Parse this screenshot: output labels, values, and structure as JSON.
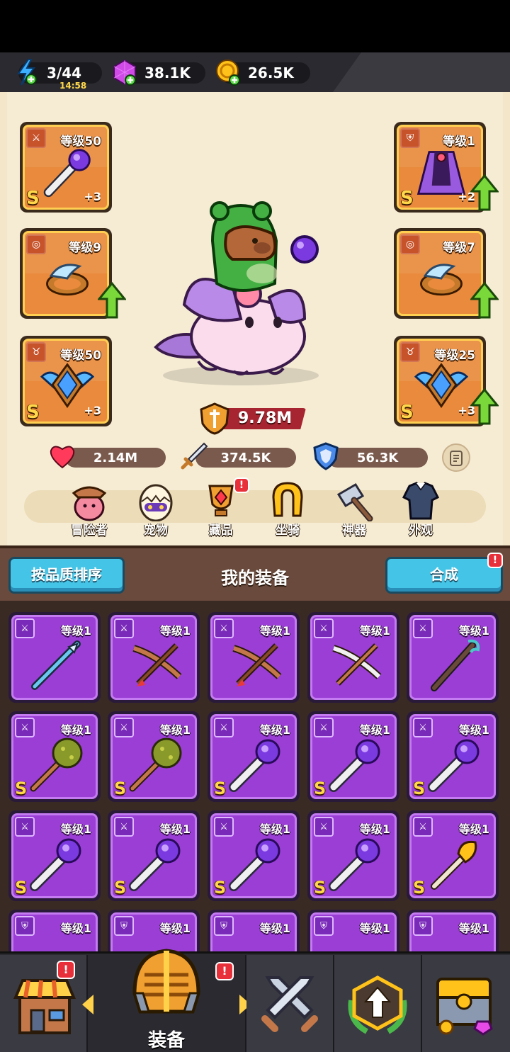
{
  "resources": {
    "energy": {
      "value": "3/44",
      "timer": "14:58",
      "icon": "lightning-bolt-icon"
    },
    "gems": {
      "value": "38.1K",
      "icon": "purple-gem-icon"
    },
    "coins": {
      "value": "26.5K",
      "icon": "gold-coin-icon"
    }
  },
  "left_slots": [
    {
      "level": "等级50",
      "rank": "S",
      "plus": "+3",
      "type": "weapon-icon",
      "item": "purple-orb-staff"
    },
    {
      "level": "等级9",
      "rank": "",
      "plus": "",
      "type": "ring-icon",
      "item": "wing-ring",
      "upgrade": true
    },
    {
      "level": "等级50",
      "rank": "S",
      "plus": "+3",
      "type": "necklace-icon",
      "item": "winged-emblem"
    }
  ],
  "right_slots": [
    {
      "level": "等级1",
      "rank": "S",
      "plus": "+2",
      "type": "armor-icon",
      "item": "purple-cape",
      "upgrade": true
    },
    {
      "level": "等级7",
      "rank": "",
      "plus": "",
      "type": "ring-icon",
      "item": "wing-ring",
      "upgrade": true
    },
    {
      "level": "等级25",
      "rank": "S",
      "plus": "+3",
      "type": "necklace-icon",
      "item": "winged-emblem",
      "upgrade": true
    }
  ],
  "power": {
    "value": "9.78M",
    "icon": "power-shield-icon"
  },
  "stats": {
    "hp": {
      "value": "2.14M",
      "icon": "heart-icon"
    },
    "attack": {
      "value": "374.5K",
      "icon": "sword-icon"
    },
    "defense": {
      "value": "56.3K",
      "icon": "shield-icon"
    }
  },
  "menu": [
    {
      "label": "冒险者",
      "icon": "adventurer-icon",
      "badge": ""
    },
    {
      "label": "宠物",
      "icon": "pet-egg-icon",
      "badge": ""
    },
    {
      "label": "藏品",
      "icon": "collection-trophy-icon",
      "badge": "!"
    },
    {
      "label": "坐骑",
      "icon": "horseshoe-icon",
      "badge": ""
    },
    {
      "label": "神器",
      "icon": "hammer-icon",
      "badge": ""
    },
    {
      "label": "外观",
      "icon": "outfit-icon",
      "badge": ""
    }
  ],
  "equipment": {
    "sort_label": "按品质排序",
    "title": "我的装备",
    "merge_label": "合成",
    "merge_badge": "!",
    "items": [
      {
        "level": "等级1",
        "rank": "",
        "art": "ice-spear",
        "type": "weapon-icon"
      },
      {
        "level": "等级1",
        "rank": "",
        "art": "crossbow",
        "type": "weapon-icon"
      },
      {
        "level": "等级1",
        "rank": "",
        "art": "crossbow",
        "type": "weapon-icon"
      },
      {
        "level": "等级1",
        "rank": "",
        "art": "bone-crossbow",
        "type": "weapon-icon"
      },
      {
        "level": "等级1",
        "rank": "",
        "art": "wood-staff",
        "type": "weapon-icon"
      },
      {
        "level": "等级1",
        "rank": "S",
        "art": "spiked-mace",
        "type": "weapon-icon"
      },
      {
        "level": "等级1",
        "rank": "S",
        "art": "spiked-mace",
        "type": "weapon-icon"
      },
      {
        "level": "等级1",
        "rank": "S",
        "art": "orb-staff",
        "type": "weapon-icon"
      },
      {
        "level": "等级1",
        "rank": "S",
        "art": "orb-staff",
        "type": "weapon-icon"
      },
      {
        "level": "等级1",
        "rank": "S",
        "art": "orb-staff",
        "type": "weapon-icon"
      },
      {
        "level": "等级1",
        "rank": "S",
        "art": "orb-staff",
        "type": "weapon-icon"
      },
      {
        "level": "等级1",
        "rank": "S",
        "art": "orb-staff",
        "type": "weapon-icon"
      },
      {
        "level": "等级1",
        "rank": "S",
        "art": "orb-staff",
        "type": "weapon-icon"
      },
      {
        "level": "等级1",
        "rank": "S",
        "art": "orb-staff",
        "type": "weapon-icon"
      },
      {
        "level": "等级1",
        "rank": "S",
        "art": "gold-club",
        "type": "weapon-icon"
      },
      {
        "level": "等级1",
        "rank": "",
        "art": "helmet",
        "type": "armor-icon"
      },
      {
        "level": "等级1",
        "rank": "",
        "art": "helmet",
        "type": "armor-icon"
      },
      {
        "level": "等级1",
        "rank": "",
        "art": "helmet",
        "type": "armor-icon"
      },
      {
        "level": "等级1",
        "rank": "",
        "art": "helmet",
        "type": "armor-icon"
      },
      {
        "level": "等级1",
        "rank": "",
        "art": "helmet",
        "type": "armor-icon"
      }
    ]
  },
  "nav": [
    {
      "label": "",
      "icon": "shop-icon",
      "badge": "!"
    },
    {
      "label": "装备",
      "icon": "equipment-helmet-icon",
      "badge": "!"
    },
    {
      "label": "",
      "icon": "crossed-swords-icon",
      "badge": ""
    },
    {
      "label": "",
      "icon": "upgrade-arrow-icon",
      "badge": ""
    },
    {
      "label": "",
      "icon": "treasure-chest-icon",
      "badge": ""
    }
  ]
}
